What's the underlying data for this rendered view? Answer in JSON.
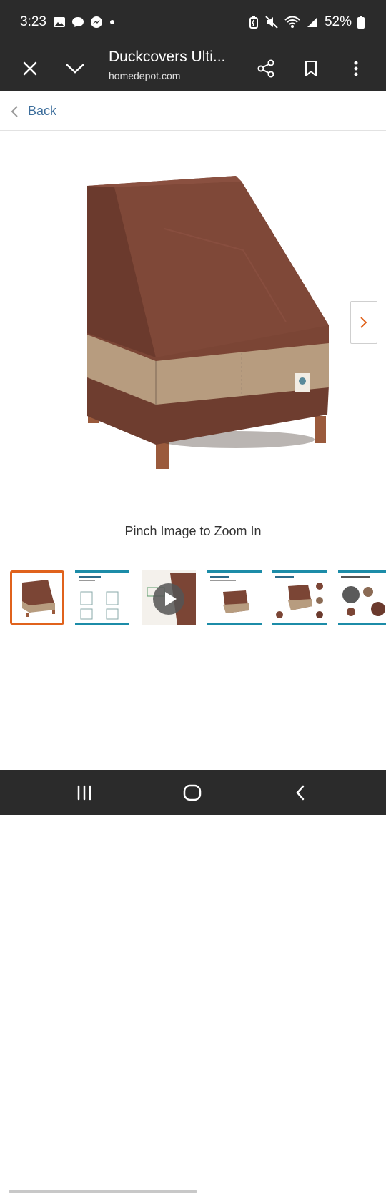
{
  "status_bar": {
    "time": "3:23",
    "battery_percent": "52%",
    "icons_left": [
      "gallery-icon",
      "chat-bubble-icon",
      "messenger-icon",
      "dot-icon"
    ],
    "icons_right": [
      "battery-saver-icon",
      "mute-icon",
      "wifi-icon",
      "signal-icon",
      "battery-icon"
    ]
  },
  "toolbar": {
    "title": "Duckcovers Ulti...",
    "url": "homedepot.com",
    "buttons": [
      "close-icon",
      "chevron-down-icon",
      "share-icon",
      "bookmark-icon",
      "more-vert-icon"
    ]
  },
  "back_bar": {
    "label": "Back"
  },
  "product_image": {
    "subject": "chair-cover-image"
  },
  "zoom_hint": "Pinch Image to Zoom In",
  "thumbnails": {
    "selected_index": 0,
    "items": [
      {
        "kind": "product"
      },
      {
        "kind": "diagram"
      },
      {
        "kind": "video"
      },
      {
        "kind": "chair"
      },
      {
        "kind": "features"
      },
      {
        "kind": "swatches"
      }
    ]
  },
  "colors": {
    "bar_dark": "#2b2b2b",
    "link_blue": "#3d6e9c",
    "accent_orange": "#e0621c",
    "cover_brown": "#7b4535",
    "cover_tan": "#b79c7f"
  },
  "nav_bar": {
    "buttons": [
      "recents-icon",
      "home-icon",
      "back-icon"
    ]
  }
}
